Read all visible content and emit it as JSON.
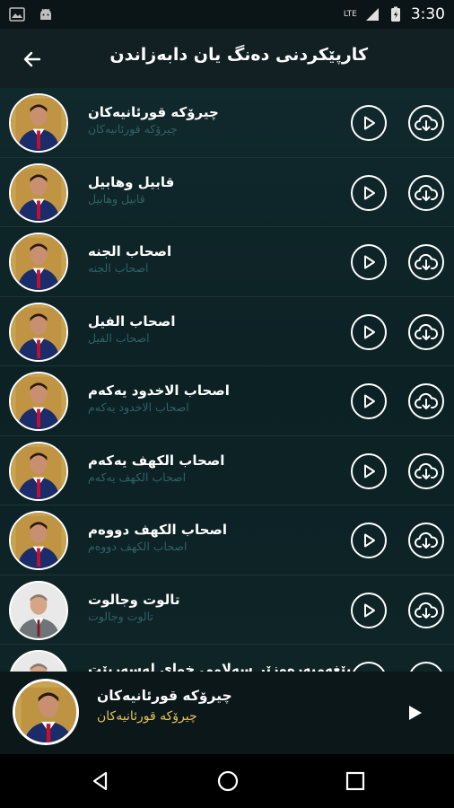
{
  "status_bar": {
    "time": "3:30",
    "network": "LTE"
  },
  "toolbar": {
    "title": "کارپێکردنی دەنگ یان دابەزاندن"
  },
  "items": [
    {
      "title": "چیرۆکە قورئانیەکان",
      "subtitle": "چیرۆکە قورئانیەکان",
      "avatar": "person-suit"
    },
    {
      "title": "قابیل وهابیل",
      "subtitle": "قابیل وهابیل",
      "avatar": "person-suit"
    },
    {
      "title": "اصحاب الجنه",
      "subtitle": "اصحاب الجنه",
      "avatar": "person-suit"
    },
    {
      "title": "اصحاب الفیل",
      "subtitle": "اصحاب الفیل",
      "avatar": "person-suit"
    },
    {
      "title": "اصحاب الاخدود یەکەم",
      "subtitle": "اصحاب الاخدود یەکەم",
      "avatar": "person-suit"
    },
    {
      "title": "اصحاب الکهف یەکەم",
      "subtitle": "اصحاب الکهف یەکەم",
      "avatar": "person-suit"
    },
    {
      "title": "اصحاب الکهف دووەم",
      "subtitle": "اصحاب الکهف دووەم",
      "avatar": "person-suit"
    },
    {
      "title": "تالوت وجالوت",
      "subtitle": "تالوت وجالوت",
      "avatar": "person-alt"
    },
    {
      "title": "پێغەمبەرەوزێر سەلامی خوای لەسەربێت",
      "subtitle": "",
      "avatar": "person-alt"
    }
  ],
  "player": {
    "title": "چیرۆکە قورئانیەکان",
    "subtitle": "چیرۆکە قورئانیەکان"
  },
  "colors": {
    "background": "#0a1a1c",
    "toolbar": "#122024",
    "subtitle_row": "#2f6266",
    "player_subtitle": "#e4c35c"
  }
}
